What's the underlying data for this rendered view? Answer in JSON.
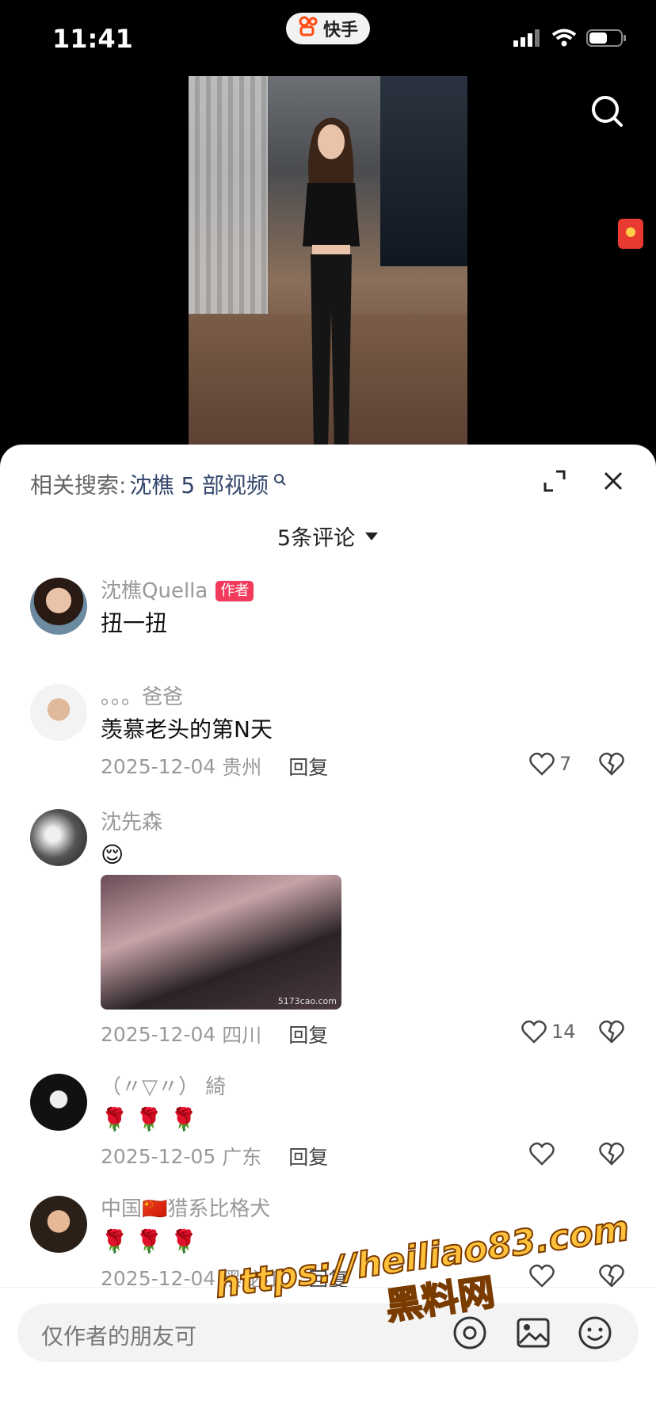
{
  "status_bar": {
    "time": "11:41",
    "app_name": "快手"
  },
  "related_search": {
    "label": "相关搜索:",
    "query": "沈樵 5 部视频"
  },
  "comments_header": {
    "count_label": "5条评论"
  },
  "comments": [
    {
      "name": "沈樵Quella",
      "tag": "作者",
      "text": "扭一扭"
    },
    {
      "name": "。。。爸爸",
      "text": "羡慕老头的第N天",
      "date": "2025-12-04",
      "location": "贵州",
      "reply": "回复",
      "likes": "7"
    },
    {
      "name": "沈先森",
      "text": "😌",
      "date": "2025-12-04",
      "location": "四川",
      "reply": "回复",
      "likes": "14",
      "image_watermark": "5173cao.com"
    },
    {
      "name": "（〃▽〃） 綺",
      "text": "🌹 🌹 🌹",
      "date": "2025-12-05",
      "location": "广东",
      "reply": "回复",
      "likes": ""
    },
    {
      "name": "中国🇨🇳猎系比格犬",
      "text": "🌹 🌹 🌹",
      "date": "2025-12-04",
      "location": "黑龙江",
      "reply": "回复",
      "likes": ""
    }
  ],
  "input": {
    "placeholder": "仅作者的朋友可"
  },
  "watermark": {
    "url": "https://heiliao83.com",
    "text": "黑料网"
  },
  "colors": {
    "accent": "#f23b5c",
    "link": "#33466b",
    "redpacket": "#e83a30"
  }
}
